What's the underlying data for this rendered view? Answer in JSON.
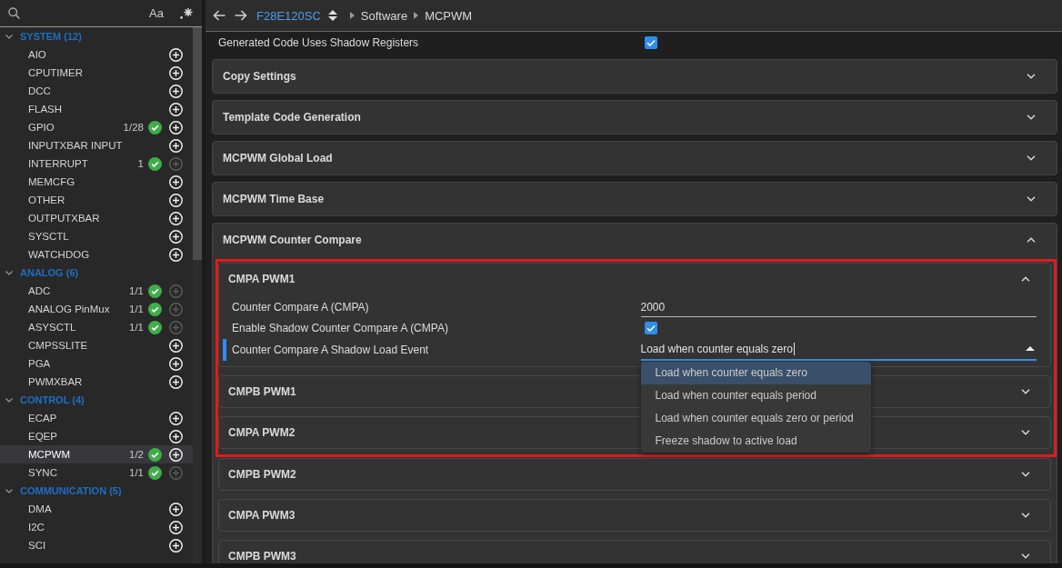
{
  "sidebar": {
    "search": {
      "case_toggle": "Aa"
    },
    "groups": [
      {
        "label": "SYSTEM (12)",
        "expanded": true,
        "items": [
          {
            "name": "AIO",
            "configured": false,
            "add_disabled": false,
            "selected": false
          },
          {
            "name": "CPUTIMER",
            "configured": false,
            "add_disabled": false,
            "selected": false
          },
          {
            "name": "DCC",
            "configured": false,
            "add_disabled": false,
            "selected": false
          },
          {
            "name": "FLASH",
            "configured": false,
            "add_disabled": false,
            "selected": false
          },
          {
            "name": "GPIO",
            "count": "1/28",
            "configured": true,
            "add_disabled": false,
            "selected": false
          },
          {
            "name": "INPUTXBAR INPUT",
            "configured": false,
            "add_disabled": false,
            "selected": false
          },
          {
            "name": "INTERRUPT",
            "count": "1",
            "configured": true,
            "add_disabled": true,
            "selected": false
          },
          {
            "name": "MEMCFG",
            "configured": false,
            "add_disabled": false,
            "selected": false
          },
          {
            "name": "OTHER",
            "configured": false,
            "add_disabled": false,
            "selected": false
          },
          {
            "name": "OUTPUTXBAR",
            "configured": false,
            "add_disabled": false,
            "selected": false
          },
          {
            "name": "SYSCTL",
            "configured": false,
            "add_disabled": false,
            "selected": false
          },
          {
            "name": "WATCHDOG",
            "configured": false,
            "add_disabled": false,
            "selected": false
          }
        ]
      },
      {
        "label": "ANALOG (6)",
        "expanded": true,
        "items": [
          {
            "name": "ADC",
            "count": "1/1",
            "configured": true,
            "add_disabled": true,
            "selected": false
          },
          {
            "name": "ANALOG PinMux",
            "count": "1/1",
            "configured": true,
            "add_disabled": true,
            "selected": false
          },
          {
            "name": "ASYSCTL",
            "count": "1/1",
            "configured": true,
            "add_disabled": true,
            "selected": false
          },
          {
            "name": "CMPSSLITE",
            "configured": false,
            "add_disabled": false,
            "selected": false
          },
          {
            "name": "PGA",
            "configured": false,
            "add_disabled": false,
            "selected": false
          },
          {
            "name": "PWMXBAR",
            "configured": false,
            "add_disabled": false,
            "selected": false
          }
        ]
      },
      {
        "label": "CONTROL (4)",
        "expanded": true,
        "items": [
          {
            "name": "ECAP",
            "configured": false,
            "add_disabled": false,
            "selected": false
          },
          {
            "name": "EQEP",
            "configured": false,
            "add_disabled": false,
            "selected": false
          },
          {
            "name": "MCPWM",
            "count": "1/2",
            "configured": true,
            "add_disabled": false,
            "selected": true
          },
          {
            "name": "SYNC",
            "count": "1/1",
            "configured": true,
            "add_disabled": true,
            "selected": false
          }
        ]
      },
      {
        "label": "COMMUNICATION (5)",
        "expanded": true,
        "items": [
          {
            "name": "DMA",
            "configured": false,
            "add_disabled": false,
            "selected": false
          },
          {
            "name": "I2C",
            "configured": false,
            "add_disabled": false,
            "selected": false
          },
          {
            "name": "SCI",
            "configured": false,
            "add_disabled": false,
            "selected": false
          }
        ]
      }
    ]
  },
  "header": {
    "device": "F28E120SC",
    "breadcrumb": [
      "Software",
      "MCPWM"
    ]
  },
  "settings": [
    {
      "kind": "checkbox",
      "label": "Generated Code Uses Shadow Registers",
      "checked": true
    }
  ],
  "sections": [
    {
      "title": "Copy Settings",
      "expanded": false
    },
    {
      "title": "Template Code Generation",
      "expanded": false
    },
    {
      "title": "MCPWM Global Load",
      "expanded": false
    },
    {
      "title": "MCPWM Time Base",
      "expanded": false
    },
    {
      "title": "MCPWM Counter Compare",
      "expanded": true,
      "subsections": [
        {
          "title": "CMPA PWM1",
          "expanded": true,
          "highlighted": true,
          "fields": [
            {
              "kind": "text",
              "label": "Counter Compare A (CMPA)",
              "value": "2000"
            },
            {
              "kind": "checkbox",
              "label": "Enable Shadow Counter Compare A (CMPA)",
              "checked": true
            },
            {
              "kind": "select",
              "label": "Counter Compare A Shadow Load Event",
              "value": "Load when counter equals zero",
              "focused": true,
              "open": true,
              "options": [
                {
                  "label": "Load when counter equals zero",
                  "selected": true
                },
                {
                  "label": "Load when counter equals period",
                  "selected": false
                },
                {
                  "label": "Load when counter equals zero or period",
                  "selected": false
                },
                {
                  "label": "Freeze shadow to active load",
                  "selected": false
                }
              ]
            }
          ]
        },
        {
          "title": "CMPB PWM1",
          "expanded": false,
          "highlighted": true
        },
        {
          "title": "CMPA PWM2",
          "expanded": false,
          "highlighted": true
        },
        {
          "title": "CMPB PWM2",
          "expanded": false,
          "highlighted": false
        },
        {
          "title": "CMPA PWM3",
          "expanded": false,
          "highlighted": false
        },
        {
          "title": "CMPB PWM3",
          "expanded": false,
          "highlighted": false
        }
      ]
    }
  ]
}
